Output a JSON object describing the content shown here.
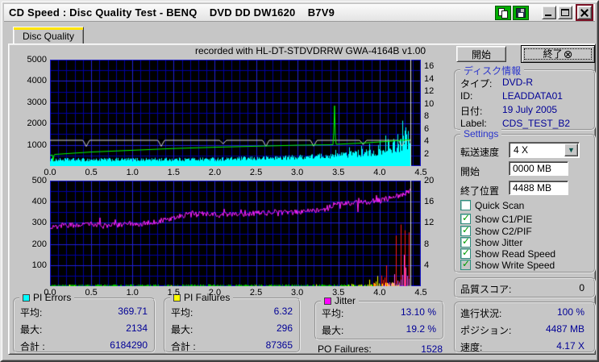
{
  "window": {
    "title": "CD Speed : Disc Quality Test - BENQ    DVD DD DW1620    B7V9"
  },
  "tab": {
    "label": "Disc Quality"
  },
  "chart_header": "recorded with HL-DT-STDVDRRW GWA-4164B v1.00",
  "icons": {
    "check": "✓",
    "combo_arrow": "▼",
    "stop": "⊗"
  },
  "controls": {
    "start_button": "開始",
    "stop_button": "終了"
  },
  "disc_info": {
    "title": "ディスク情報",
    "rows": [
      {
        "label": "タイプ:",
        "value": "DVD-R"
      },
      {
        "label": "ID:",
        "value": "LEADDATA01"
      },
      {
        "label": "日付:",
        "value": "19 July 2005"
      },
      {
        "label": "Label:",
        "value": "CDS_TEST_B2"
      }
    ]
  },
  "settings": {
    "title": "Settings",
    "speed_label": "転送速度",
    "speed_value": "4 X",
    "start_label": "開始",
    "start_value": "0000 MB",
    "end_label": "終了位置",
    "end_value": "4488 MB",
    "checkboxes": [
      {
        "label": "Quick Scan",
        "checked": false,
        "disabled": false
      },
      {
        "label": "Show C1/PIE",
        "checked": true,
        "disabled": false
      },
      {
        "label": "Show C2/PIF",
        "checked": true,
        "disabled": false
      },
      {
        "label": "Show Jitter",
        "checked": true,
        "disabled": false
      },
      {
        "label": "Show Read Speed",
        "checked": true,
        "disabled": false
      },
      {
        "label": "Show Write Speed",
        "checked": true,
        "disabled": true
      }
    ]
  },
  "quality_score": {
    "label": "品質スコア:",
    "value": "0"
  },
  "progress": {
    "rows": [
      {
        "label": "進行状況:",
        "value": "100 %"
      },
      {
        "label": "ポジション:",
        "value": "4487 MB"
      },
      {
        "label": "速度:",
        "value": "4.17 X"
      }
    ]
  },
  "stats": {
    "groups": [
      {
        "title": "PI Errors",
        "color": "#00FFFF",
        "rows": [
          {
            "label": "平均:",
            "value": "369.71"
          },
          {
            "label": "最大:",
            "value": "2134"
          },
          {
            "label": "合計 :",
            "value": "6184290"
          }
        ]
      },
      {
        "title": "PI Failures",
        "color": "#FFFF00",
        "rows": [
          {
            "label": "平均:",
            "value": "6.32"
          },
          {
            "label": "最大:",
            "value": "296"
          },
          {
            "label": "合計 :",
            "value": "87365"
          }
        ]
      },
      {
        "title": "Jitter",
        "color": "#FF00FF",
        "rows": [
          {
            "label": "平均:",
            "value": "13.10 %"
          },
          {
            "label": "最大:",
            "value": "19.2 %"
          }
        ]
      }
    ],
    "po_failures": {
      "label": "PO Failures:",
      "value": "1528"
    }
  },
  "chart_data": [
    {
      "type": "area",
      "x_range": [
        0,
        4.5
      ],
      "x_ticks": [
        "0.0",
        "0.5",
        "1.0",
        "1.5",
        "2.0",
        "2.5",
        "3.0",
        "3.5",
        "4.0",
        "4.5"
      ],
      "y_left": {
        "max": 5000,
        "ticks": [
          5000,
          4000,
          3000,
          2000,
          1000
        ]
      },
      "y_right": {
        "max": 17.1,
        "ticks": [
          16,
          14,
          12,
          10,
          8,
          6,
          4,
          2
        ]
      },
      "data_end_x": 4.37,
      "cursor_x": 4.37,
      "series": [
        {
          "name": "pi_errors",
          "legend": "PI Errors",
          "color": "#00FFFF",
          "style": "area_noise",
          "points": [
            [
              0,
              300
            ],
            [
              0.5,
              300
            ],
            [
              1,
              305
            ],
            [
              1.5,
              315
            ],
            [
              2,
              330
            ],
            [
              2.5,
              360
            ],
            [
              3,
              420
            ],
            [
              3.25,
              465
            ],
            [
              3.5,
              515
            ],
            [
              3.75,
              585
            ],
            [
              4,
              680
            ],
            [
              4.2,
              840
            ],
            [
              4.3,
              940
            ],
            [
              4.37,
              880
            ]
          ],
          "noise": 0.55,
          "spike_start": 3.25,
          "spike_max": 1600,
          "spikes": [
            [
              3.46,
              760
            ],
            [
              4.22,
              1500
            ],
            [
              4.275,
              2134
            ],
            [
              4.31,
              1820
            ],
            [
              4.345,
              1650
            ]
          ]
        },
        {
          "name": "read_speed",
          "legend": "Read Speed",
          "color": "#D8D8D8",
          "style": "dipline",
          "level": 1230,
          "dip_width": 0.04,
          "dips": [
            [
              0.44,
              940
            ],
            [
              1.35,
              950
            ],
            [
              2.1,
              1060
            ],
            [
              2.62,
              945
            ],
            [
              3.2,
              950
            ],
            [
              3.8,
              1020
            ],
            [
              4.27,
              955
            ]
          ]
        },
        {
          "name": "write_speed",
          "legend": "Write Speed",
          "color": "#00FF00",
          "style": "line",
          "points": [
            [
              0,
              520
            ],
            [
              0.03,
              545
            ],
            [
              0.038,
              235
            ],
            [
              0.05,
              565
            ],
            [
              0.5,
              680
            ],
            [
              1,
              762
            ],
            [
              1.5,
              845
            ],
            [
              2,
              905
            ],
            [
              2.5,
              952
            ],
            [
              3,
              1000
            ],
            [
              3.44,
              1022
            ],
            [
              3.452,
              3050
            ],
            [
              3.465,
              1040
            ],
            [
              3.8,
              1105
            ],
            [
              4.1,
              1180
            ],
            [
              4.37,
              1262
            ]
          ]
        }
      ]
    },
    {
      "type": "mixed",
      "x_range": [
        0,
        4.5
      ],
      "x_ticks": [
        "0.0",
        "0.5",
        "1.0",
        "1.5",
        "2.0",
        "2.5",
        "3.0",
        "3.5",
        "4.0",
        "4.5"
      ],
      "y_left": {
        "max": 500,
        "ticks": [
          500,
          400,
          300,
          200,
          100
        ]
      },
      "y_right": {
        "max": 20,
        "ticks": [
          20,
          16,
          12,
          8,
          4
        ]
      },
      "data_end_x": 4.37,
      "cursor_x": 4.37,
      "series": [
        {
          "name": "c1_pie_baseline",
          "legend": "C1/PIE",
          "color": "#00CC00",
          "style": "baseline",
          "max": 5
        },
        {
          "name": "pi_failures",
          "legend": "PI Failures",
          "color": "#FFFF00",
          "style": "spikes",
          "region": [
            3.5,
            4.25
          ],
          "peak_x": 4.02,
          "max": 62,
          "density": 0.6,
          "scatter_max": 8,
          "scatter_density": 0.05
        },
        {
          "name": "po_failures",
          "legend": "PO Failures",
          "color": "#FF1818",
          "style": "spikes",
          "region": [
            3.86,
            4.37
          ],
          "peak_x": 4.37,
          "max": 292,
          "density": 0.45,
          "peaks": [
            [
              4.2,
              240
            ],
            [
              4.26,
              292
            ],
            [
              4.3,
              265
            ],
            [
              4.35,
              255
            ]
          ]
        },
        {
          "name": "failures_dense",
          "legend": "",
          "color": "#FF50E8",
          "style": "spikes",
          "region": [
            4.0,
            4.37
          ],
          "peak_x": 4.37,
          "max": 205,
          "density": 0.85
        },
        {
          "name": "jitter",
          "legend": "Jitter",
          "color": "#FF22FF",
          "style": "noisy_line",
          "noise": 13,
          "points": [
            [
              0,
              283
            ],
            [
              0.2,
              291
            ],
            [
              0.5,
              294
            ],
            [
              0.8,
              291
            ],
            [
              1,
              293
            ],
            [
              1.2,
              301
            ],
            [
              1.5,
              323
            ],
            [
              1.7,
              346
            ],
            [
              2,
              341
            ],
            [
              2.3,
              343
            ],
            [
              2.6,
              348
            ],
            [
              3,
              352
            ],
            [
              3.3,
              361
            ],
            [
              3.45,
              388
            ],
            [
              3.6,
              393
            ],
            [
              3.8,
              398
            ],
            [
              4,
              408
            ],
            [
              4.15,
              420
            ],
            [
              4.3,
              440
            ],
            [
              4.37,
              452
            ]
          ]
        }
      ]
    }
  ]
}
